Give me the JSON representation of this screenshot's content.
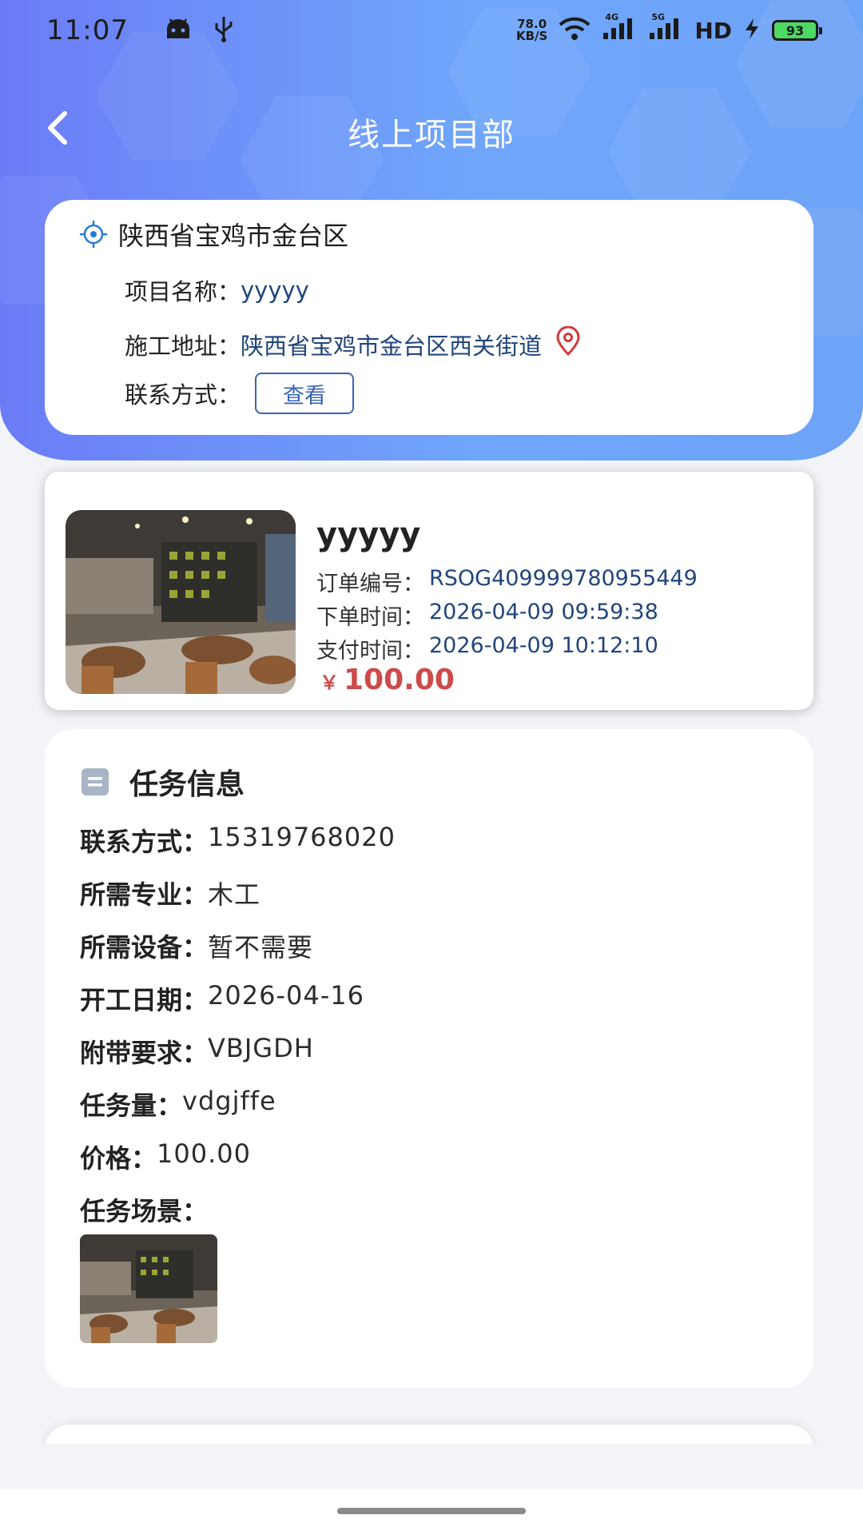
{
  "status_bar": {
    "time": "11:07",
    "net_speed_value": "78.0",
    "net_speed_unit": "KB/S",
    "net_4g": "4G",
    "net_5g": "5G",
    "hd": "HD",
    "battery": "93"
  },
  "nav": {
    "title": "线上项目部",
    "back_icon": "chevron-left-icon"
  },
  "location_card": {
    "region": "陕西省宝鸡市金台区",
    "project_name_label": "项目名称：",
    "project_name": "yyyyy",
    "address_label": "施工地址：",
    "address": "陕西省宝鸡市金台区西关街道",
    "contact_label": "联系方式：",
    "view_button": "查看"
  },
  "order_card": {
    "name": "yyyyy",
    "order_no_label": "订单编号：",
    "order_no": "RSOG409999780955449",
    "order_time_label": "下单时间：",
    "order_time": "2026-04-09 09:59:38",
    "pay_time_label": "支付时间：",
    "pay_time": "2026-04-09 10:12:10",
    "currency": "￥",
    "price": "100.00"
  },
  "task_card": {
    "title": "任务信息",
    "rows": [
      {
        "label": "联系方式：",
        "value": "15319768020"
      },
      {
        "label": "所需专业：",
        "value": "木工"
      },
      {
        "label": "所需设备：",
        "value": "暂不需要"
      },
      {
        "label": "开工日期：",
        "value": "2026-04-16"
      },
      {
        "label": "附带要求：",
        "value": "VBJGDH"
      },
      {
        "label": "任务量：",
        "value": "vdgjffe"
      },
      {
        "label": "价格：",
        "value": "100.00"
      }
    ],
    "scene_label": "任务场景："
  },
  "colors": {
    "accent_blue": "#6fa6fb",
    "price_red": "#cc4b4b",
    "value_blue": "#22457a"
  }
}
